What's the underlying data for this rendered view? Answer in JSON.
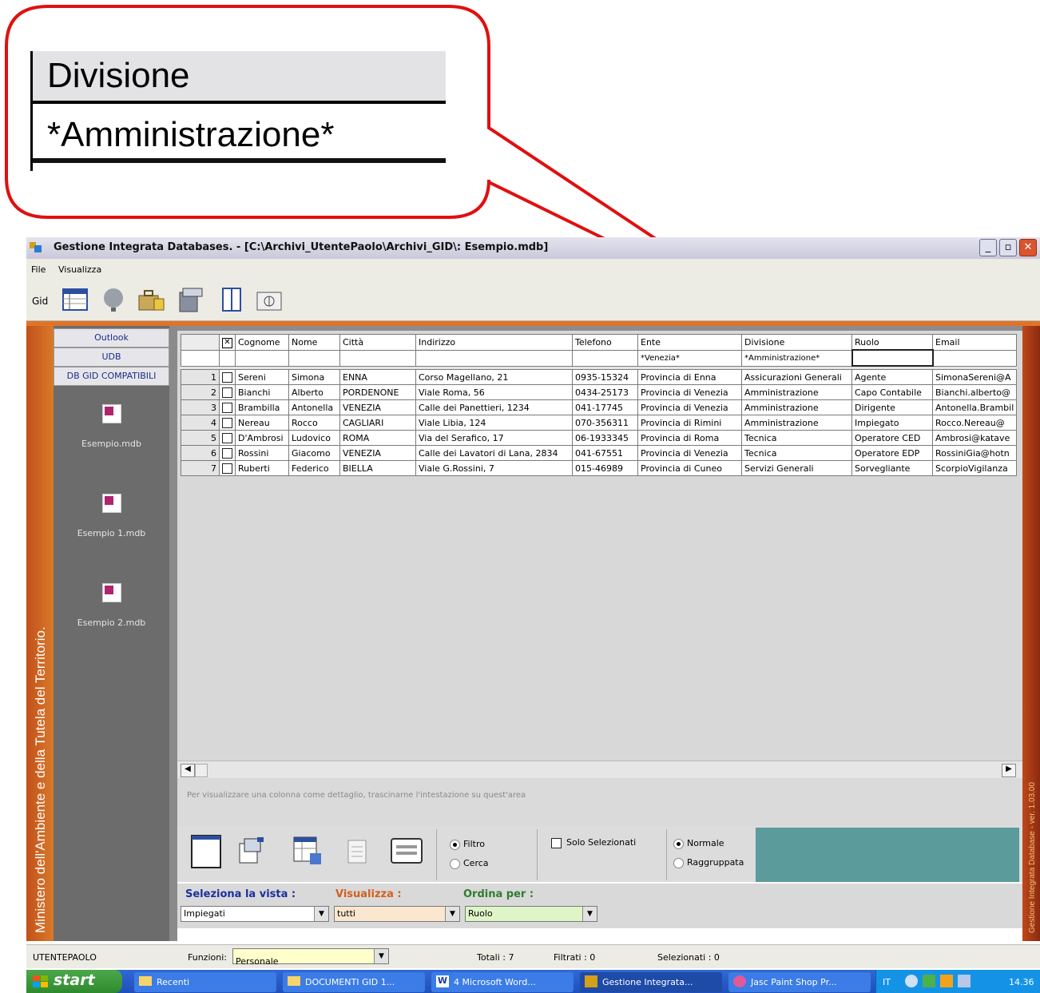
{
  "callout": {
    "field_label": "Divisione",
    "field_value": "*Amministrazione*"
  },
  "window": {
    "title": "Gestione Integrata Databases. - [C:\\Archivi_UtentePaolo\\Archivi_GID\\: Esempio.mdb]",
    "minimize": "_",
    "maximize": "▫",
    "close": "✕"
  },
  "menu": {
    "file": "File",
    "visualizza": "Visualizza"
  },
  "toolbar": {
    "gid_label": "Gid"
  },
  "left_strip_text": "Ministero dell'Ambiente e della Tutela del Territorio.",
  "right_strip_text": "Gestione Integrata Database - ver. 1.03.00",
  "nav": {
    "buttons": [
      "Outlook",
      "UDB",
      "DB GID COMPATIBILI"
    ],
    "databases": [
      "Esempio.mdb",
      "Esempio 1.mdb",
      "Esempio 2.mdb"
    ]
  },
  "grid": {
    "headers": [
      "Cognome",
      "Nome",
      "Città",
      "Indirizzo",
      "Telefono",
      "Ente",
      "Divisione",
      "Ruolo",
      "Email"
    ],
    "filters": [
      "",
      "",
      "",
      "",
      "",
      "*Venezia*",
      "*Amministrazione*",
      "",
      ""
    ],
    "rows": [
      [
        "1",
        "Sereni",
        "Simona",
        "ENNA",
        "Corso Magellano, 21",
        "0935-15324",
        "Provincia di Enna",
        "Assicurazioni Generali",
        "Agente",
        "SimonaSereni@A"
      ],
      [
        "2",
        "Bianchi",
        "Alberto",
        "PORDENONE",
        "Viale Roma, 56",
        "0434-25173",
        "Provincia di Venezia",
        "Amministrazione",
        "Capo Contabile",
        "Bianchi.alberto@"
      ],
      [
        "3",
        "Brambilla",
        "Antonella",
        "VENEZIA",
        "Calle dei Panettieri, 1234",
        "041-17745",
        "Provincia di Venezia",
        "Amministrazione",
        "Dirigente",
        "Antonella.Brambil"
      ],
      [
        "4",
        "Nereau",
        "Rocco",
        "CAGLIARI",
        "Viale Libia, 124",
        "070-356311",
        "Provincia di Rimini",
        "Amministrazione",
        "Impiegato",
        "Rocco.Nereau@"
      ],
      [
        "5",
        "D'Ambrosi",
        "Ludovico",
        "ROMA",
        "Via del Serafico, 17",
        "06-1933345",
        "Provincia di Roma",
        "Tecnica",
        "Operatore CED",
        "Ambrosi@katave"
      ],
      [
        "6",
        "Rossini",
        "Giacomo",
        "VENEZIA",
        "Calle dei Lavatori di Lana, 2834",
        "041-67551",
        "Provincia di Venezia",
        "Tecnica",
        "Operatore EDP",
        "RossiniGia@hotn"
      ],
      [
        "7",
        "Ruberti",
        "Federico",
        "BIELLA",
        "Viale G.Rossini, 7",
        "015-46989",
        "Provincia di Cuneo",
        "Servizi Generali",
        "Sorvegliante",
        "ScorpioVigilanza"
      ]
    ]
  },
  "hint": "Per visualizzare una colonna come dettaglio, trascinarne l'intestazione su quest'area",
  "options": {
    "filtro": "Filtro",
    "cerca": "Cerca",
    "solo_selezionati": "Solo Selezionati",
    "normale": "Normale",
    "raggruppata": "Raggruppata"
  },
  "selectors": {
    "vista_label": "Seleziona la vista :",
    "vista_value": "Impiegati",
    "visualizza_label": "Visualizza :",
    "visualizza_value": "tutti",
    "ordina_label": "Ordina per :",
    "ordina_value": "Ruolo"
  },
  "colors": {
    "vista_label": "#1d2fa0",
    "visualizza_label": "#d2601e",
    "ordina_label": "#2e7d2e",
    "vista_bg": "#ffffff",
    "visualizza_bg": "#fbe7cf",
    "ordina_bg": "#def5c7",
    "funzioni_bg": "#ffffcc"
  },
  "status": {
    "user": "UTENTEPAOLO",
    "funzioni_label": "Funzioni:",
    "funzioni_value": "Personale",
    "totali": "Totali : 7",
    "filtrati": "Filtrati : 0",
    "selezionati": "Selezionati : 0"
  },
  "taskbar": {
    "start": "start",
    "tasks": [
      "Recenti",
      "DOCUMENTI GID 1...",
      "4 Microsoft Word...",
      "Gestione Integrata...",
      "Jasc Paint Shop Pr..."
    ],
    "lang": "IT",
    "clock": "14.36"
  }
}
